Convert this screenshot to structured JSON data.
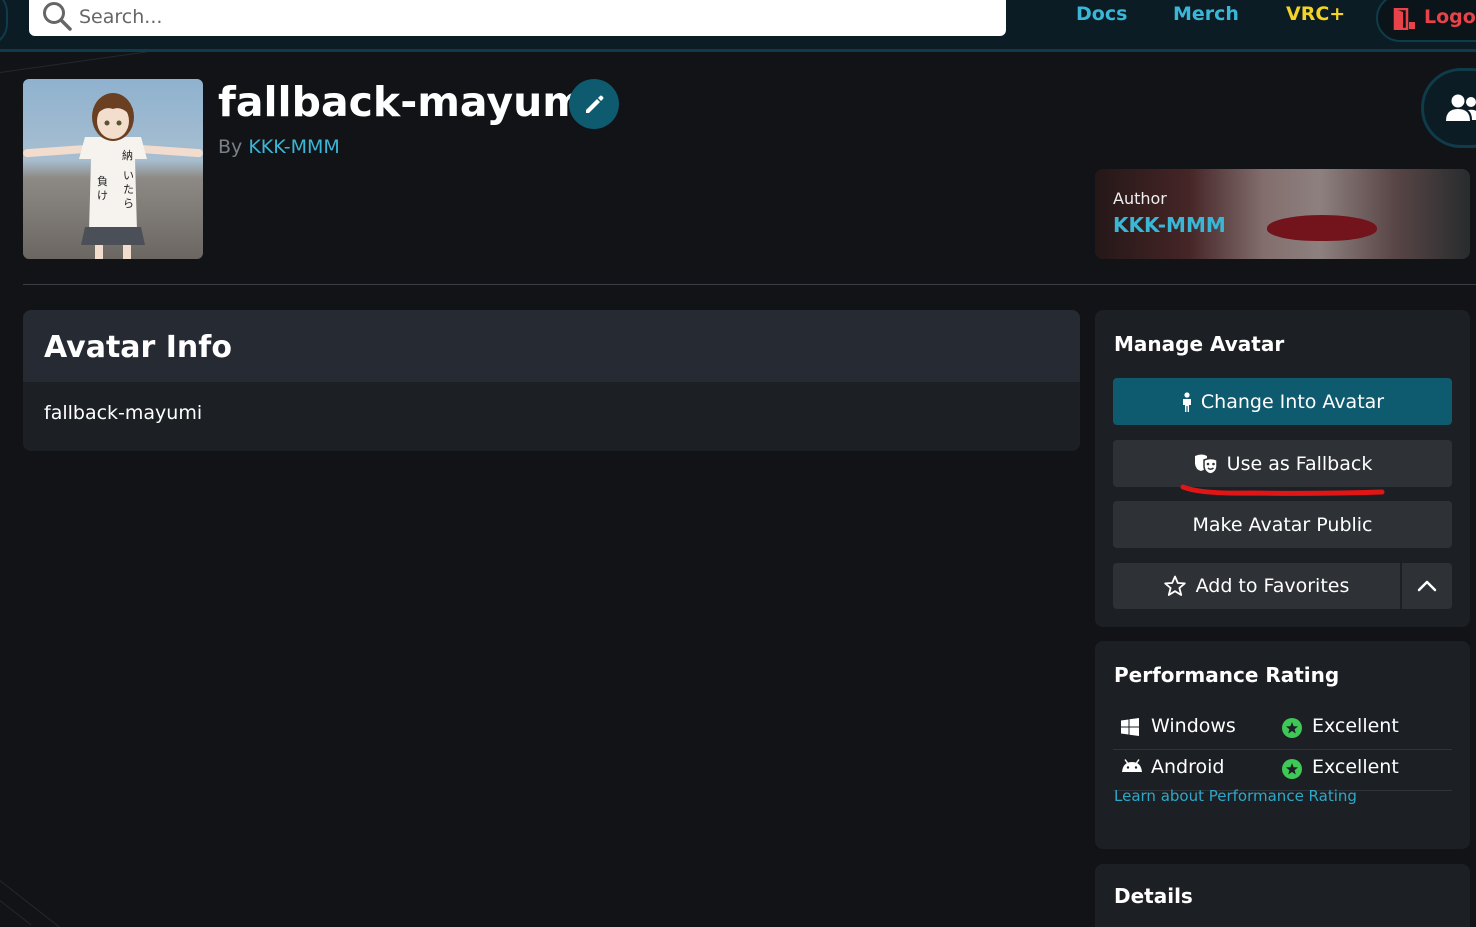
{
  "nav": {
    "search_placeholder": "Search...",
    "links": [
      {
        "label": "Docs",
        "color": "#3ab6d6"
      },
      {
        "label": "Merch",
        "color": "#3ab6d6"
      },
      {
        "label": "VRC+",
        "color": "#f3d325"
      }
    ],
    "logout_label": "Logou"
  },
  "avatar": {
    "title": "fallback-mayumi",
    "by_prefix": "By",
    "author": "KKK-MMM"
  },
  "author_card": {
    "label": "Author",
    "name": "KKK-MMM"
  },
  "avatar_info": {
    "heading": "Avatar Info",
    "description": "fallback-mayumi"
  },
  "manage": {
    "heading": "Manage Avatar",
    "change_label": "Change Into Avatar",
    "fallback_label": "Use as Fallback",
    "public_label": "Make Avatar Public",
    "favorites_label": "Add to Favorites"
  },
  "performance": {
    "heading": "Performance Rating",
    "rows": [
      {
        "platform": "Windows",
        "rating": "Excellent"
      },
      {
        "platform": "Android",
        "rating": "Excellent"
      }
    ],
    "learn_link": "Learn about Performance Rating"
  },
  "details": {
    "heading": "Details"
  },
  "colors": {
    "accent": "#3ab6d6",
    "primary_button": "#0e5a6e",
    "excellent": "#3fc856",
    "logout": "#e8434a"
  }
}
